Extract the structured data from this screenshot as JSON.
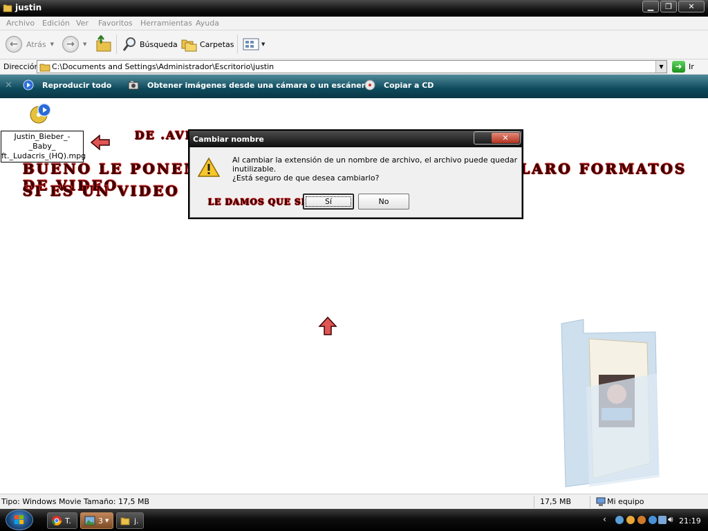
{
  "window": {
    "title": "justin"
  },
  "menu": [
    "Archivo",
    "Edición",
    "Ver",
    "Favoritos",
    "Herramientas",
    "Ayuda"
  ],
  "toolbar": {
    "back_label": "Atrás",
    "search_label": "Búsqueda",
    "folders_label": "Carpetas"
  },
  "address": {
    "label": "Dirección",
    "path": "C:\\Documents and Settings\\Administrador\\Escritorio\\justin",
    "go_label": "Ir"
  },
  "commands": {
    "play_all": "Reproducir todo",
    "get_images": "Obtener imágenes desde una cámara o un escáner",
    "copy_cd": "Copiar a CD"
  },
  "file": {
    "name_line1": "Justin_Bieber_-_Baby_",
    "name_line2": "ft._Ludacris_(HQ).mpg"
  },
  "annotations": {
    "top": "DE .AVI  A .MPG",
    "line1": "BUENO LE PONEMOS EL FORMATO Q QUERAMOS CLARO FORMATOS DE VIDEO",
    "line2": "SI ES UN VIDEO",
    "dialog": "LE DAMOS QUE SI"
  },
  "dialog": {
    "title": "Cambiar nombre",
    "message1": "Al cambiar la extensión de un nombre de archivo, el archivo puede quedar inutilizable.",
    "message2": "¿Está seguro de que desea cambiarlo?",
    "yes_label": "Sí",
    "no_label": "No"
  },
  "status": {
    "type_info": "Tipo: Windows Movie Tamaño: 17,5 MB",
    "size": "17,5 MB",
    "location": "Mi equipo"
  },
  "taskbar": {
    "task1": "T.",
    "task2": "3",
    "task3": "j.",
    "clock": "21:19"
  },
  "colors": {
    "annotation": "#3d0000",
    "command_bar": "#0d4a5c",
    "go_button": "#2fae2f"
  }
}
